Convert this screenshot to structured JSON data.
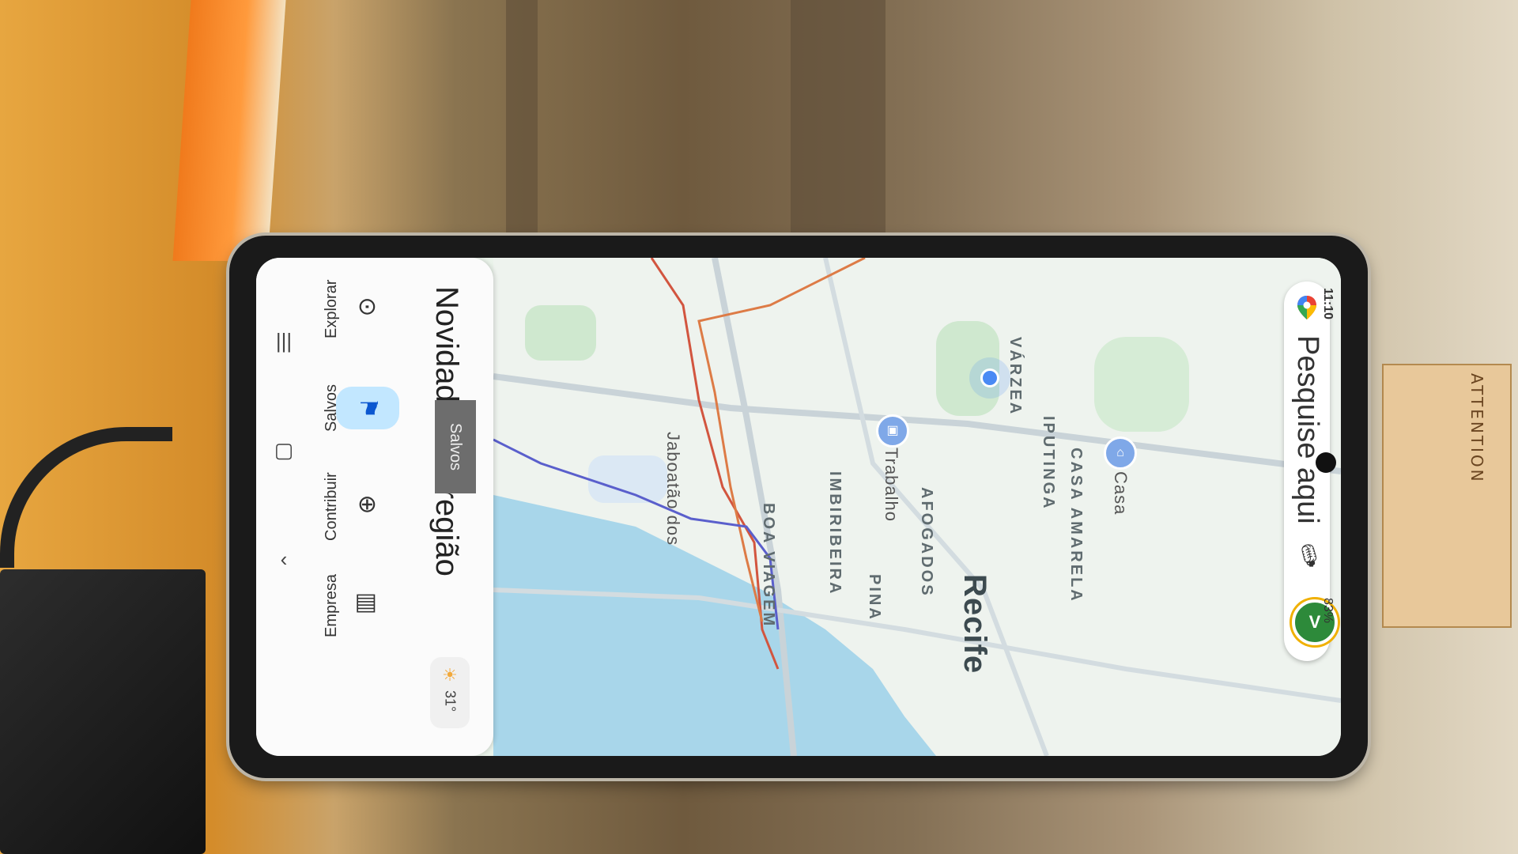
{
  "status_bar": {
    "time": "11:10",
    "battery": "83%"
  },
  "search": {
    "placeholder": "Pesquise aqui",
    "avatar_initial": "V"
  },
  "map": {
    "neighborhoods": [
      "VÁRZEA",
      "IPUTINGA",
      "CASA AMARELA",
      "AFOGADOS",
      "IMBIRIBEIRA",
      "BOA VIAGEM",
      "PINA",
      "Jaboatão dos"
    ],
    "city": "Recife",
    "places": [
      {
        "label": "Casa",
        "icon": "home-icon"
      },
      {
        "label": "Trabalho",
        "icon": "briefcase-icon"
      }
    ]
  },
  "panel": {
    "heading": "Novidades na região",
    "weather_temp": "31°",
    "tooltip": "Salvos",
    "tabs": [
      {
        "label": "Explorar",
        "icon": "explore-pin-icon",
        "active": false
      },
      {
        "label": "Salvos",
        "icon": "bookmark-icon",
        "active": true
      },
      {
        "label": "Contribuir",
        "icon": "add-circle-icon",
        "active": false
      },
      {
        "label": "Empresa",
        "icon": "storefront-icon",
        "active": false
      }
    ]
  },
  "system_nav": [
    {
      "icon": "recents-icon"
    },
    {
      "icon": "home-square-icon"
    },
    {
      "icon": "back-chevron-icon"
    }
  ]
}
